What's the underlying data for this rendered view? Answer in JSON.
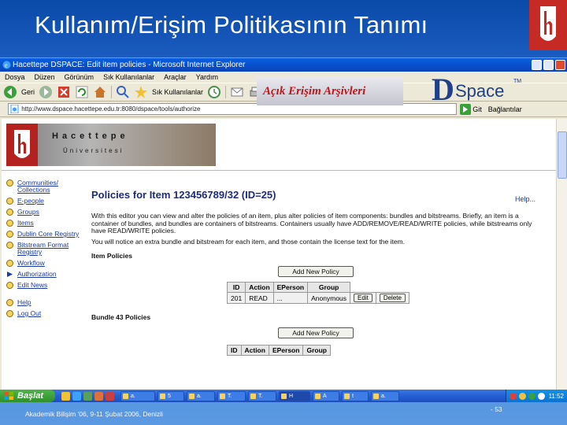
{
  "slide": {
    "title": "Kullanım/Erişim Politikasının Tanımı",
    "footer_left": "Akademik Bilişim '06, 9-11 Şubat 2006, Denizli",
    "footer_right": "- 53"
  },
  "browser": {
    "window_title": "Hacettepe DSPACE: Edit item policies - Microsoft Internet Explorer",
    "menu": [
      "Dosya",
      "Düzen",
      "Görünüm",
      "Sık Kullanılanlar",
      "Araçlar",
      "Yardım"
    ],
    "toolbar": {
      "back_label": "Geri",
      "favorites_label": "Sık Kullanılanlar"
    },
    "address": {
      "url": "http://www.dspace.hacettepe.edu.tr:8080/dspace/tools/authorize",
      "go_label": "Git",
      "links_label": "Bağlantılar"
    }
  },
  "page": {
    "banner": {
      "hu_name": "Hacettepe",
      "hu_sub": "Üniversitesi",
      "acik_text": "Açık Erişim Arşivleri",
      "dspace_d": "D",
      "dspace_text": "Space",
      "dspace_tm": "TM"
    },
    "sidebar": {
      "group1": [
        "Communities/ Collections",
        "E-people",
        "Groups",
        "Items",
        "Dublin Core Registry",
        "Bitstream Format Registry",
        "Workflow",
        "Authorization",
        "Edit News"
      ],
      "group2": [
        "Help",
        "Log Out"
      ]
    },
    "content": {
      "title": "Policies for Item 123456789/32 (ID=25)",
      "help": "Help...",
      "para1": "With this editor you can view and alter the policies of an item, plus alter policies of item components: bundles and bitstreams. Briefly, an item is a container of bundles, and bundles are containers of bitstreams. Containers usually have ADD/REMOVE/READ/WRITE policies, while bitstreams only have READ/WRITE policies.",
      "para2": "You will notice an extra bundle and bitstream for each item, and those contain the license text for the item.",
      "item_policies_heading": "Item Policies",
      "add_policy_label": "Add New Policy",
      "columns": [
        "ID",
        "Action",
        "EPerson",
        "Group"
      ],
      "item_policy_rows": [
        {
          "id": "201",
          "action": "READ",
          "eperson": "...",
          "group": "Anonymous",
          "edit": "Edit",
          "delete": "Delete"
        }
      ],
      "bundle_heading": "Bundle 43 Policies",
      "bundle_add_policy_label": "Add New Policy"
    }
  },
  "taskbar": {
    "start_label": "Başlat",
    "tasks": [
      "a.",
      "5",
      "a.",
      "T.",
      "T.",
      "H",
      "A",
      "t",
      "a."
    ],
    "clock": "11:52"
  },
  "colors": {
    "slide_bg": "#1b5cc0",
    "xp_title": "#0a5fe0",
    "link": "#1a3aa0",
    "item_title": "#1d2c7a",
    "acik_red": "#c0151b"
  }
}
